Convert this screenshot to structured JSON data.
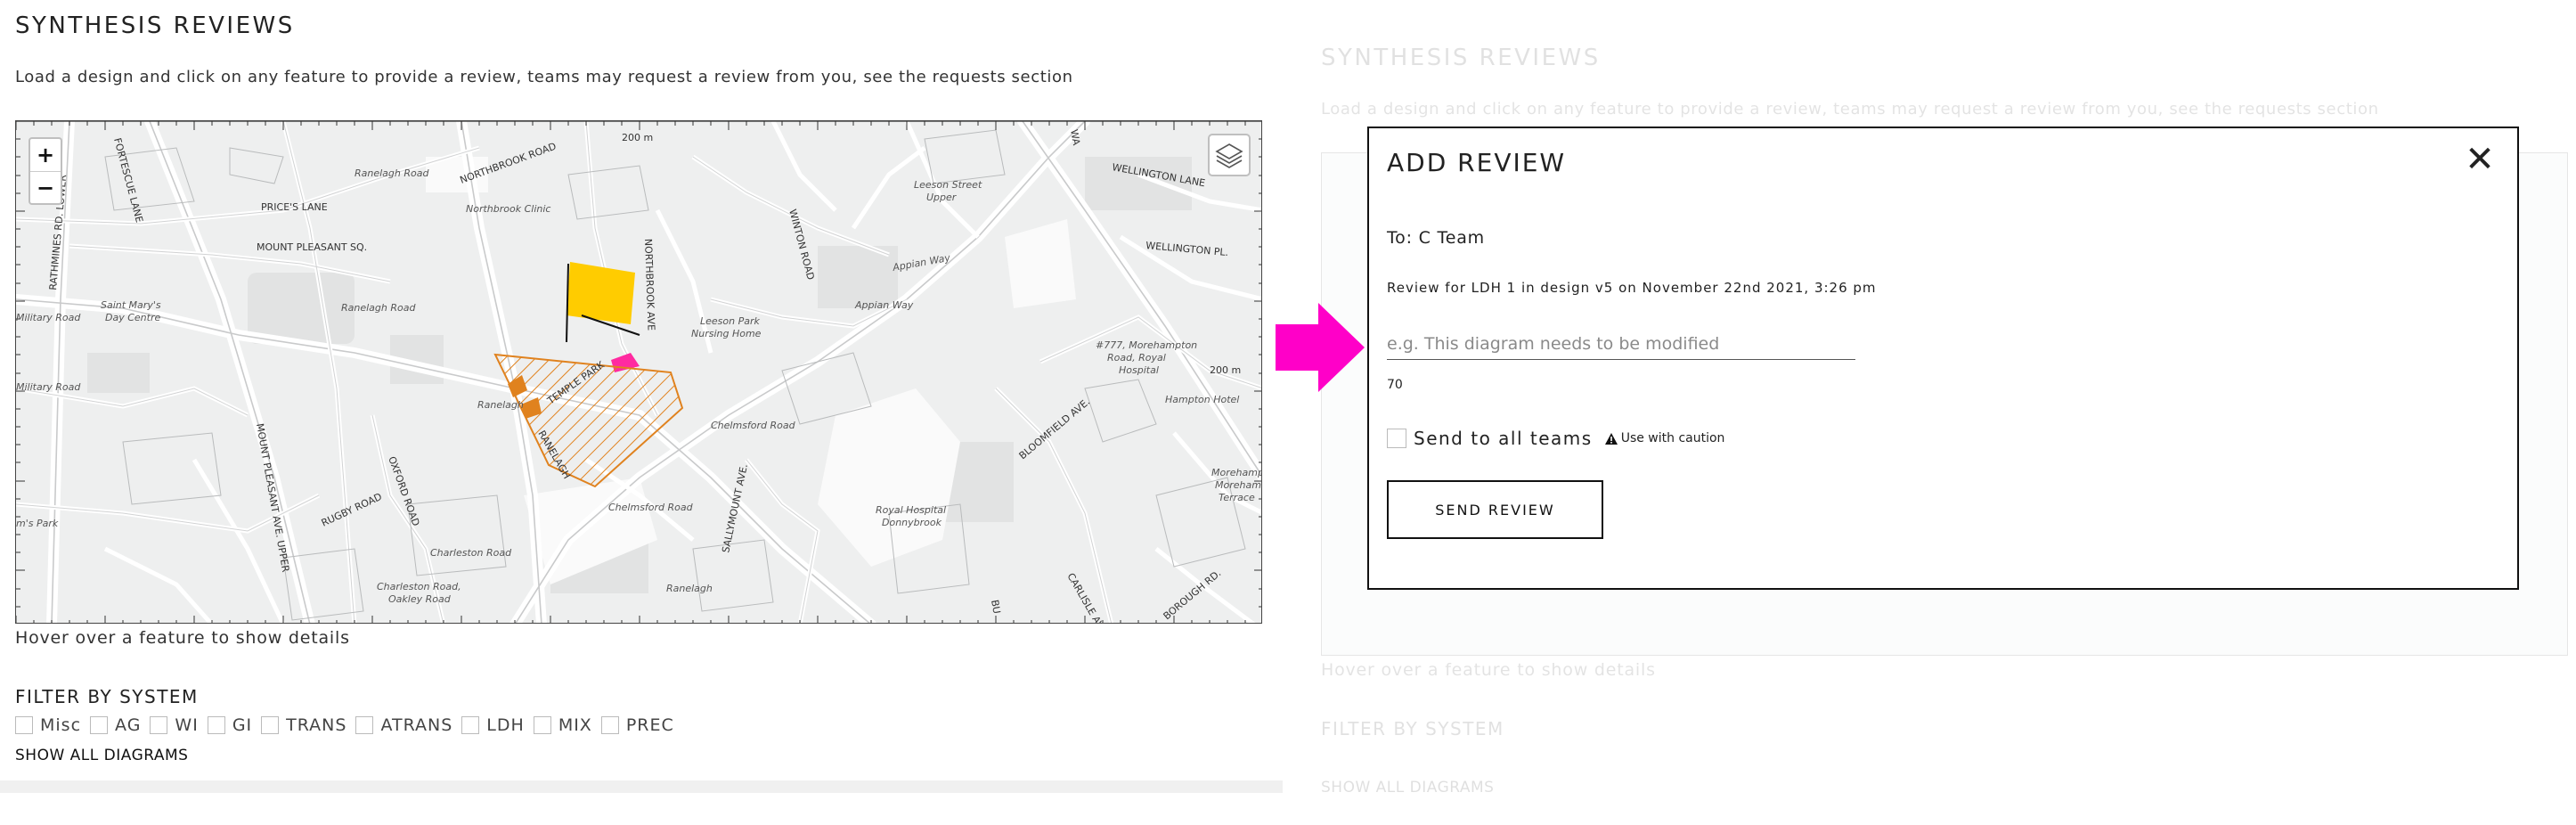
{
  "page": {
    "title": "SYNTHESIS REVIEWS",
    "intro": "Load a design and click on any feature to provide a review, teams may request a review from you, see the requests section",
    "hover_hint": "Hover over a feature to show details",
    "filter_title": "FILTER BY SYSTEM",
    "filters": [
      "Misc",
      "AG",
      "WI",
      "GI",
      "TRANS",
      "ATRANS",
      "LDH",
      "MIX",
      "PREC"
    ],
    "show_all": "SHOW ALL DIAGRAMS"
  },
  "map": {
    "zoom_in": "+",
    "zoom_out": "−",
    "scale_top": "200 m",
    "scale_right": "200 m",
    "labels": {
      "fortescue": "FORTESCUE LANE",
      "ranelagh_road_1": "Ranelagh Road",
      "northbrook_road": "NORTHBROOK ROAD",
      "northbrook_clinic": "Northbrook Clinic",
      "prices_lane": "PRICE'S LANE",
      "mount_pleasant_sq": "MOUNT PLEASANT SQ.",
      "ranelagh_road_2": "Ranelagh Road",
      "saint_marys": "Saint Mary's",
      "day_centre": "Day Centre",
      "military_road_1": "Military Road",
      "military_road_2": "Military Road",
      "rathmines": "RATHMINES RD. LOWER",
      "mount_pleasant_ave": "MOUNT PLEASANT AVE. UPPER",
      "oxford_road": "OXFORD ROAD",
      "rugby_road": "RUGBY ROAD",
      "charleston_road_1": "Charleston Road",
      "charleston_road_2": "Charleston Road,",
      "oakley_road": "Oakley Road",
      "ms_park": "m's Park",
      "northbrook_ave": "NORTHBROOK AVE",
      "leeson_park": "Leeson Park",
      "nursing_home": "Nursing Home",
      "temple_park": "TEMPLE PARK",
      "ranelagh_1": "Ranelagh",
      "ranelagh_2": "RANELAGH",
      "ranelagh_3": "Ranelagh",
      "chelmsford_road_1": "Chelmsford Road",
      "chelmsford_road_2": "Chelmsford Road",
      "winton_road": "WINTON ROAD",
      "appian_way_1": "Appian Way",
      "appian_way_2": "Appian Way",
      "leeson_street_1": "Leeson Street",
      "leeson_street_2": "Upper",
      "sallymount_ave": "SALLYMOUNT AVE.",
      "royal_hospital_1": "Royal Hospital",
      "royal_hospital_2": "Donnybrook",
      "wellington_lane": "WELLINGTON LANE",
      "wellington_pl": "WELLINGTON PL.",
      "morehampton_1": "#777, Morehampton",
      "morehampton_2": "Road, Royal",
      "morehampton_3": "Hospital",
      "hampton_hotel": "Hampton Hotel",
      "bloomfield_ave": "BLOOMFIELD AVE.",
      "carlisle_ave": "CARLISLE AVE.",
      "borough_rd": "BOROUGH RD.",
      "morehampton_east_1": "Morehampto",
      "morehampton_east_2": "Morehamp",
      "morehampton_east_3": "Terrace",
      "bu": "BU",
      "wa": "WA"
    }
  },
  "modal": {
    "title": "ADD REVIEW",
    "close": "✕",
    "to": "To: C Team",
    "review_for": "Review for LDH 1 in design v5 on November 22nd 2021, 3:26 pm",
    "placeholder": "e.g. This diagram needs to be modified",
    "counter": "70",
    "send_all_label": "Send to all teams",
    "caution_label": "Use with caution",
    "send_button": "SEND REVIEW"
  },
  "colors": {
    "arrow": "#ff00c8",
    "selected_feature": "#ffcc00",
    "ldh_feature": "#e0821e",
    "pink_feature": "#ff2aa0"
  },
  "icons": {
    "layers": "layers-icon",
    "close": "close-icon",
    "warning": "warning-icon",
    "arrow": "pointer-arrow-icon"
  }
}
